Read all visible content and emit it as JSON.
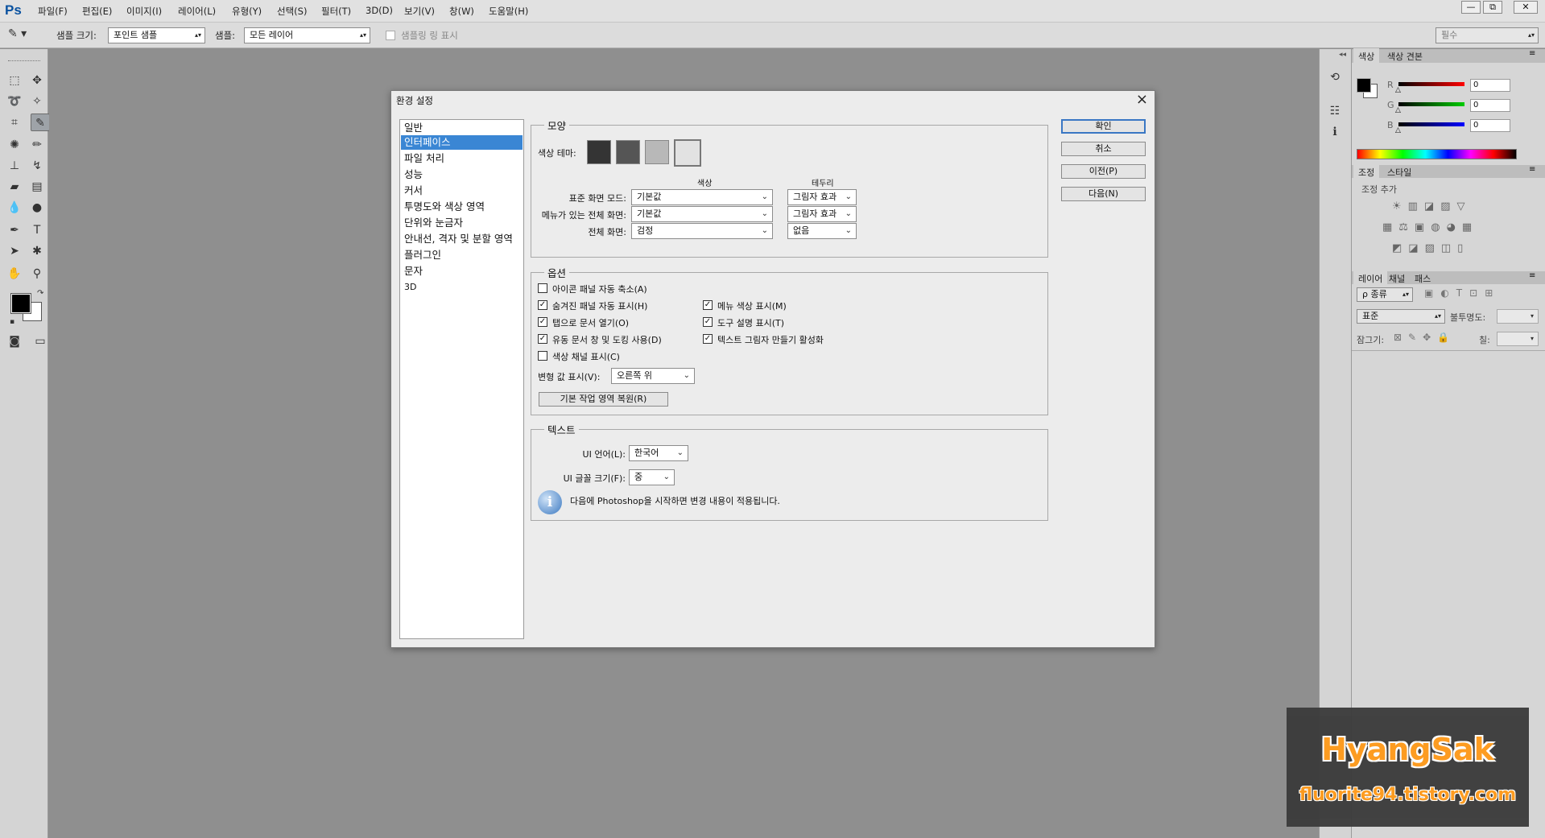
{
  "app": {
    "logo": "Ps"
  },
  "menubar": {
    "items": [
      "파일(F)",
      "편집(E)",
      "이미지(I)",
      "레이어(L)",
      "유형(Y)",
      "선택(S)",
      "필터(T)",
      "3D(D)",
      "보기(V)",
      "창(W)",
      "도움말(H)"
    ],
    "window_buttons": [
      "—",
      "⧉",
      "✕"
    ]
  },
  "options": {
    "sample_size_label": "샘플 크기:",
    "sample_size_value": "포인트 샘플",
    "sample_label": "샘플:",
    "sample_value": "모든 레이어",
    "show_ring_label": "샘플링 링 표시",
    "workspace_value": "필수"
  },
  "dialog": {
    "title": "환경 설정",
    "categories": [
      "일반",
      "인터페이스",
      "파일 처리",
      "성능",
      "커서",
      "투명도와 색상 영역",
      "단위와 눈금자",
      "안내선, 격자 및 분할 영역",
      "플러그인",
      "문자",
      "3D"
    ],
    "selected_category": "인터페이스",
    "buttons": {
      "ok": "확인",
      "cancel": "취소",
      "prev": "이전(P)",
      "next": "다음(N)"
    },
    "appearance": {
      "title": "모양",
      "color_theme_label": "색상 테마:",
      "theme_colors": [
        "#343434",
        "#555555",
        "#b8b8b8",
        "#e2e2e2"
      ],
      "col_color": "색상",
      "col_border": "테두리",
      "rows": [
        {
          "label": "표준 화면 모드:",
          "color": "기본값",
          "border": "그림자 효과"
        },
        {
          "label": "메뉴가 있는 전체 화면:",
          "color": "기본값",
          "border": "그림자 효과"
        },
        {
          "label": "전체 화면:",
          "color": "검정",
          "border": "없음"
        }
      ]
    },
    "options": {
      "title": "옵션",
      "left": [
        {
          "label": "아이콘 패널 자동 축소(A)",
          "checked": false
        },
        {
          "label": "숨겨진 패널 자동 표시(H)",
          "checked": true
        },
        {
          "label": "탭으로 문서 열기(O)",
          "checked": true
        },
        {
          "label": "유동 문서 창 및 도킹 사용(D)",
          "checked": true
        },
        {
          "label": "색상 채널 표시(C)",
          "checked": false
        }
      ],
      "right": [
        {
          "label": "메뉴 색상 표시(M)",
          "checked": true
        },
        {
          "label": "도구 설명 표시(T)",
          "checked": true
        },
        {
          "label": "텍스트 그림자 만들기 활성화",
          "checked": true
        }
      ],
      "transform_label": "변형 값 표시(V):",
      "transform_value": "오른쪽 위",
      "restore_button": "기본 작업 영역 복원(R)"
    },
    "text": {
      "title": "텍스트",
      "ui_lang_label": "UI 언어(L):",
      "ui_lang_value": "한국어",
      "ui_font_label": "UI 글꼴 크기(F):",
      "ui_font_value": "중",
      "info": "다음에 Photoshop을 시작하면 변경 내용이 적용됩니다."
    }
  },
  "panels": {
    "color_tabs": [
      "색상",
      "색상 견본"
    ],
    "rgb": [
      {
        "ch": "R",
        "val": "0",
        "color": "#d00000"
      },
      {
        "ch": "G",
        "val": "0",
        "color": "#00a000"
      },
      {
        "ch": "B",
        "val": "0",
        "color": "#0000c0"
      }
    ],
    "adjust_tabs": [
      "조정",
      "스타일"
    ],
    "adjust_add": "조정 추가",
    "layer_tabs": [
      "레이어",
      "채널",
      "패스"
    ],
    "kind_label": "ρ 종류",
    "blend_value": "표준",
    "opacity_label": "불투명도:",
    "lock_label": "잠그기:",
    "fill_label": "칠:"
  },
  "watermark": {
    "line1": "HyangSak",
    "line2": "fluorite94.tistory.com"
  }
}
